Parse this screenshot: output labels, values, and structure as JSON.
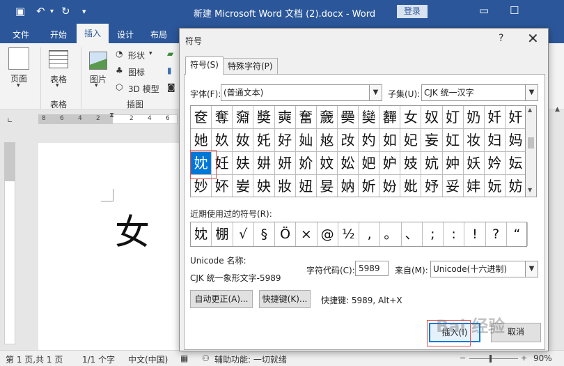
{
  "window": {
    "title": "新建 Microsoft Word 文档 (2).docx - Word",
    "login": "登录"
  },
  "ribbon_tabs": [
    "文件",
    "开始",
    "插入",
    "设计",
    "布局"
  ],
  "ribbon": {
    "pages_label": "页面",
    "table_label": "表格",
    "table_group": "表格",
    "picture_label": "图片",
    "shapes_label": "形状",
    "icons_label": "图标",
    "model3d_label": "3D 模型",
    "illustration_group": "插图"
  },
  "ruler": {
    "left_ticks": [
      "8",
      "6",
      "4",
      "2"
    ],
    "right_ticks": [
      "2",
      "4",
      "6"
    ]
  },
  "document": {
    "char": "女"
  },
  "dialog": {
    "title": "符号",
    "help": "?",
    "close": "✕",
    "tabs": [
      "符号(S)",
      "特殊字符(P)"
    ],
    "font_label": "字体(F):",
    "font_value": "(普通文本)",
    "subset_label": "子集(U):",
    "subset_value": "CJK 统一汉字",
    "grid": [
      [
        "奁",
        "奪",
        "奫",
        "奬",
        "奭",
        "奮",
        "奯",
        "奰",
        "奱",
        "奲",
        "女",
        "奴",
        "奵",
        "奶",
        "奷",
        "奸"
      ],
      [
        "她",
        "奺",
        "奻",
        "奼",
        "好",
        "奾",
        "奿",
        "妀",
        "妁",
        "如",
        "妃",
        "妄",
        "妅",
        "妆",
        "妇",
        "妈"
      ],
      [
        "妉",
        "妊",
        "妋",
        "妌",
        "妍",
        "妎",
        "妏",
        "妐",
        "妑",
        "妒",
        "妓",
        "妔",
        "妕",
        "妖",
        "妗",
        "妘"
      ],
      [
        "妙",
        "妚",
        "妛",
        "妜",
        "妝",
        "妞",
        "妟",
        "妠",
        "妡",
        "妢",
        "妣",
        "妤",
        "妥",
        "妦",
        "妧",
        "妨"
      ]
    ],
    "selected": {
      "row": 2,
      "col": 0
    },
    "recent_label": "近期使用过的符号(R):",
    "recent": [
      "妉",
      "棚",
      "√",
      "§",
      "Ö",
      "×",
      "@",
      "½",
      ",",
      "。",
      "、",
      ";",
      ":",
      "!",
      "?",
      "“"
    ],
    "unicode_name_label": "Unicode 名称:",
    "unicode_name": "CJK 统一象形文字-5989",
    "char_code_label": "字符代码(C):",
    "char_code": "5989",
    "from_label": "来自(M):",
    "from_value": "Unicode(十六进制)",
    "autocorrect_btn": "自动更正(A)...",
    "shortcut_btn": "快捷键(K)...",
    "shortcut_text": "快捷键: 5989, Alt+X",
    "insert_btn": "插入(I)",
    "cancel_btn": "取消"
  },
  "statusbar": {
    "page": "第 1 页,共 1 页",
    "words": "1/1 个字",
    "lang": "中文(中国)",
    "accessibility": "辅助功能: 一切就绪",
    "zoom": "90%"
  },
  "watermark": "Bai 经验"
}
